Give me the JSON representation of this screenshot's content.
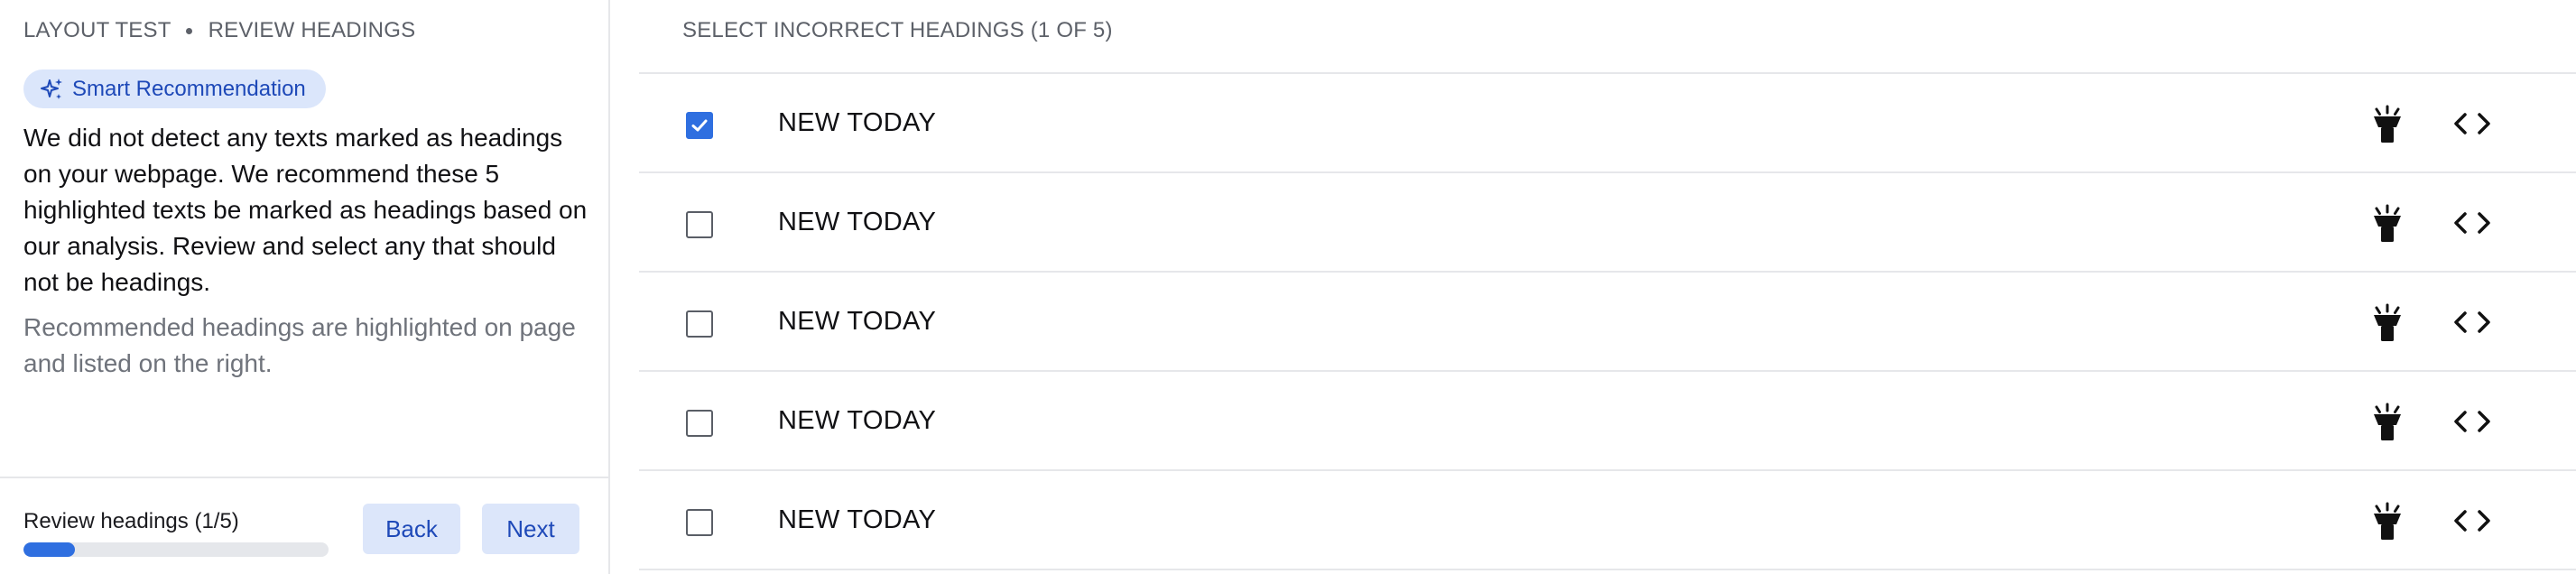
{
  "breadcrumb": {
    "section": "LAYOUT TEST",
    "page": "REVIEW HEADINGS"
  },
  "badge": {
    "label": "Smart Recommendation",
    "icon": "sparkle-icon"
  },
  "description": "We did not detect any texts marked as headings on your webpage. We recommend these 5 highlighted texts be marked as headings based on our analysis. Review and select any that should not be headings.",
  "subdescription": "Recommended headings are highlighted on page and listed on the right.",
  "footer": {
    "progress_label": "Review headings (1/5)",
    "progress_value": 0.17,
    "back_label": "Back",
    "next_label": "Next"
  },
  "list": {
    "header": "SELECT INCORRECT HEADINGS (1 OF 5)",
    "rows": [
      {
        "label": "NEW TODAY",
        "checked": true
      },
      {
        "label": "NEW TODAY",
        "checked": false
      },
      {
        "label": "NEW TODAY",
        "checked": false
      },
      {
        "label": "NEW TODAY",
        "checked": false
      },
      {
        "label": "NEW TODAY",
        "checked": false
      }
    ],
    "row_icons": [
      "flashlight-icon",
      "code-icon"
    ]
  },
  "colors": {
    "accent": "#2f6fe0",
    "badge_bg": "#dbe6fb",
    "badge_text": "#1e49b8",
    "muted_text": "#6f737b",
    "divider": "#e6e7ea"
  }
}
